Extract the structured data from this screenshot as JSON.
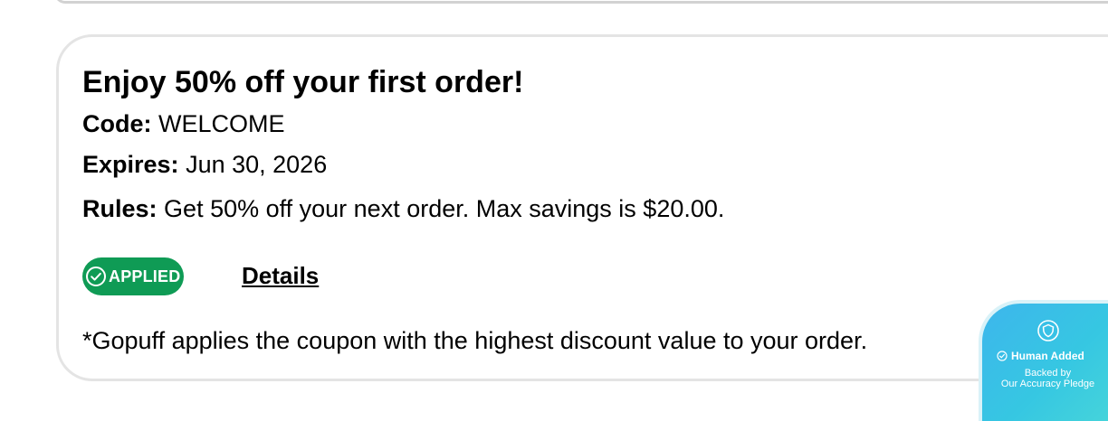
{
  "coupon": {
    "title": "Enjoy 50% off your first order!",
    "code_label": "Code:",
    "code_value": "WELCOME",
    "expires_label": "Expires:",
    "expires_value": "Jun 30, 2026",
    "rules_label": "Rules:",
    "rules_value": "Get 50% off your next order. Max savings is $20.00.",
    "status_label": "APPLIED",
    "status_icon": "check-circle-icon",
    "details_label": "Details",
    "footnote": "*Gopuff applies the coupon with the highest discount value to your order."
  },
  "pledge": {
    "icon": "shield-icon",
    "title": "Human Added",
    "subtitle_line1": "Backed by",
    "subtitle_line2": "Our Accuracy Pledge"
  },
  "colors": {
    "applied_green": "#0f9b55",
    "pledge_blue": "#3db6ec",
    "card_border": "#e4e4e4"
  }
}
